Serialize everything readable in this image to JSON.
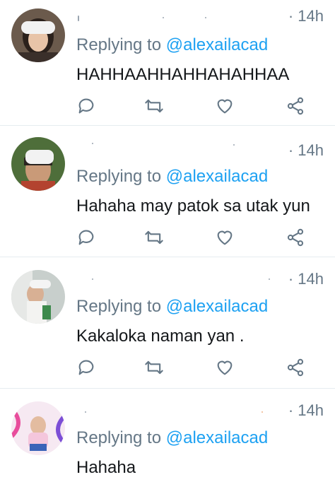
{
  "tweets": [
    {
      "time": "· 14h",
      "reply_prefix": "Replying to",
      "reply_handle": "@alexailacad",
      "text": "HAHHAAHHAHHAHAHHAA"
    },
    {
      "time": "· 14h",
      "reply_prefix": "Replying to",
      "reply_handle": "@alexailacad",
      "text": "Hahaha may patok sa utak yun"
    },
    {
      "time": "· 14h",
      "reply_prefix": "Replying to",
      "reply_handle": "@alexailacad",
      "text": "Kakaloka naman yan ."
    },
    {
      "time": "· 14h",
      "reply_prefix": "Replying to",
      "reply_handle": "@alexailacad",
      "text": "Hahaha"
    }
  ],
  "actions": [
    "reply-icon",
    "retweet-icon",
    "like-icon",
    "share-icon"
  ],
  "colors": {
    "link": "#1da1f2",
    "secondary_text": "#657786",
    "icon": "#657786",
    "divider": "#e6ecf0"
  }
}
